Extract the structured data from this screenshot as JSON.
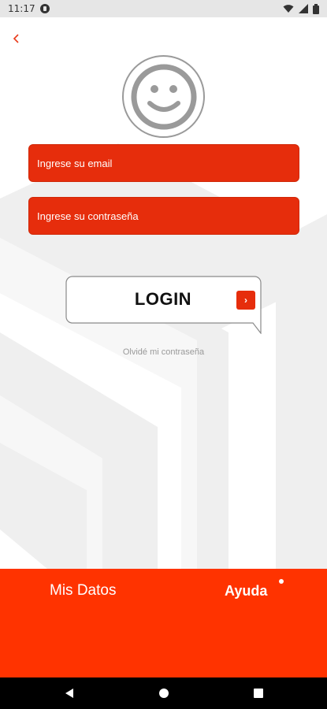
{
  "status_bar": {
    "time": "11:17"
  },
  "header": {
    "back_icon": "chevron-left-icon"
  },
  "avatar": {
    "icon": "smiley-face-icon"
  },
  "form": {
    "email_placeholder": "Ingrese su email",
    "password_placeholder": "Ingrese su contraseña",
    "login_label": "LOGIN",
    "login_arrow_icon": "chevron-right-icon",
    "forgot_password": "Olvidé mi contraseña"
  },
  "footer": {
    "mis_datos": "Mis Datos",
    "ayuda": "Ayuda"
  },
  "nav": {
    "back_icon": "triangle-back-icon",
    "home_icon": "circle-home-icon",
    "recents_icon": "square-recents-icon"
  },
  "colors": {
    "accent": "#ff3300",
    "field": "#e62d0c",
    "footer": "#ff3300"
  }
}
